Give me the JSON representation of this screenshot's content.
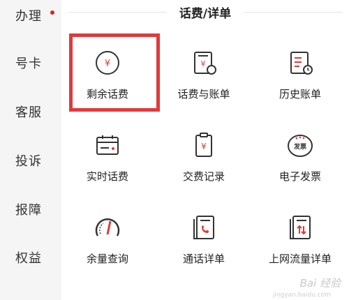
{
  "sidebar": {
    "items": [
      {
        "label": "办理",
        "badge": true
      },
      {
        "label": "号卡",
        "badge": false
      },
      {
        "label": "客服",
        "badge": false
      },
      {
        "label": "投诉",
        "badge": false
      },
      {
        "label": "报障",
        "badge": false
      },
      {
        "label": "权益",
        "badge": false
      }
    ]
  },
  "section": {
    "title": "话费/详单"
  },
  "grid": [
    {
      "label": "剩余话费",
      "icon": "yen-circle-icon"
    },
    {
      "label": "话费与账单",
      "icon": "bill-phone-icon"
    },
    {
      "label": "历史账单",
      "icon": "history-bill-icon"
    },
    {
      "label": "实时话费",
      "icon": "realtime-fee-icon"
    },
    {
      "label": "交费记录",
      "icon": "payment-record-icon"
    },
    {
      "label": "电子发票",
      "icon": "e-invoice-icon"
    },
    {
      "label": "余量查询",
      "icon": "gauge-icon"
    },
    {
      "label": "通话详单",
      "icon": "call-detail-icon"
    },
    {
      "label": "上网流量详单",
      "icon": "data-usage-icon"
    }
  ],
  "icon_texts": {
    "yen": "¥",
    "invoice": "发票"
  },
  "watermark": {
    "brand": "Bai 经验",
    "url": "jingyan.baidu.com"
  },
  "colors": {
    "accent": "#e03a3a",
    "icon_stroke": "#333333"
  }
}
